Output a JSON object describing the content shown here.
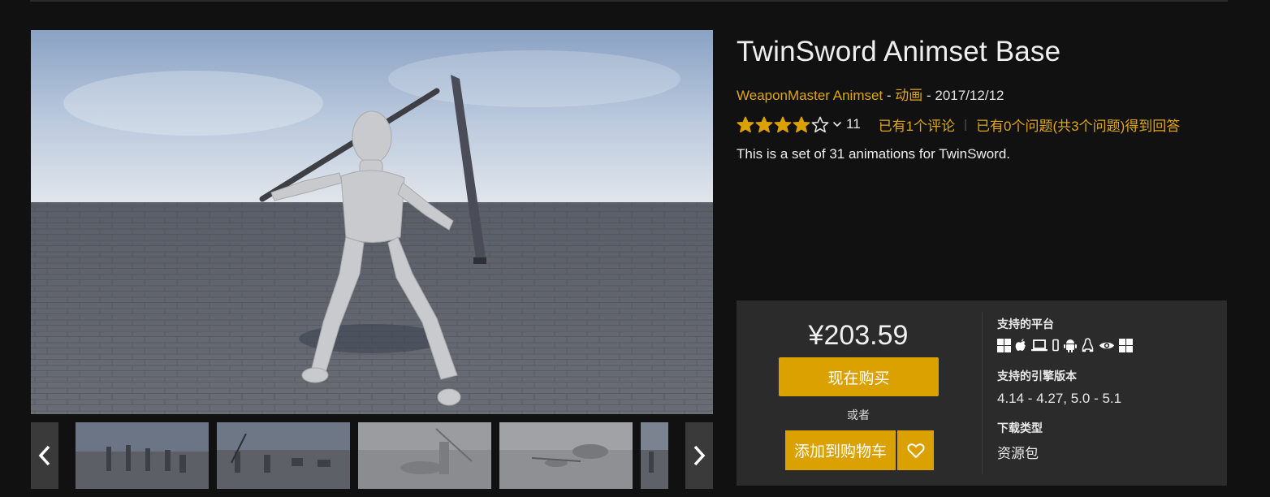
{
  "product": {
    "title": "TwinSword Animset Base",
    "seller": "WeaponMaster Animset",
    "meta_sep1": " - ",
    "category": "动画",
    "meta_sep2": " - ",
    "date": "2017/12/12",
    "rating": 4,
    "rating_max": 5,
    "rating_count": "11",
    "reviews_link": "已有1个评论",
    "questions_link": "已有0个问题(共3个问题)得到回答",
    "description": "This is a set of 31 animations for TwinSword."
  },
  "purchase": {
    "price": "¥203.59",
    "buy_label": "现在购买",
    "or_label": "或者",
    "cart_label": "添加到购物车"
  },
  "specs": {
    "platforms_label": "支持的平台",
    "platform_icons": [
      "windows-icon",
      "apple-icon",
      "mac-laptop-icon",
      "ios-phone-icon",
      "android-icon",
      "linux-icon",
      "vr-eye-icon",
      "windows-icon"
    ],
    "engine_label": "支持的引擎版本",
    "engine_versions": "4.14 - 4.27, 5.0 - 5.1",
    "download_label": "下载类型",
    "download_type": "资源包"
  },
  "colors": {
    "accent": "#dba100",
    "link": "#e0a70e",
    "background": "#111111",
    "panel": "#2b2b2b"
  }
}
